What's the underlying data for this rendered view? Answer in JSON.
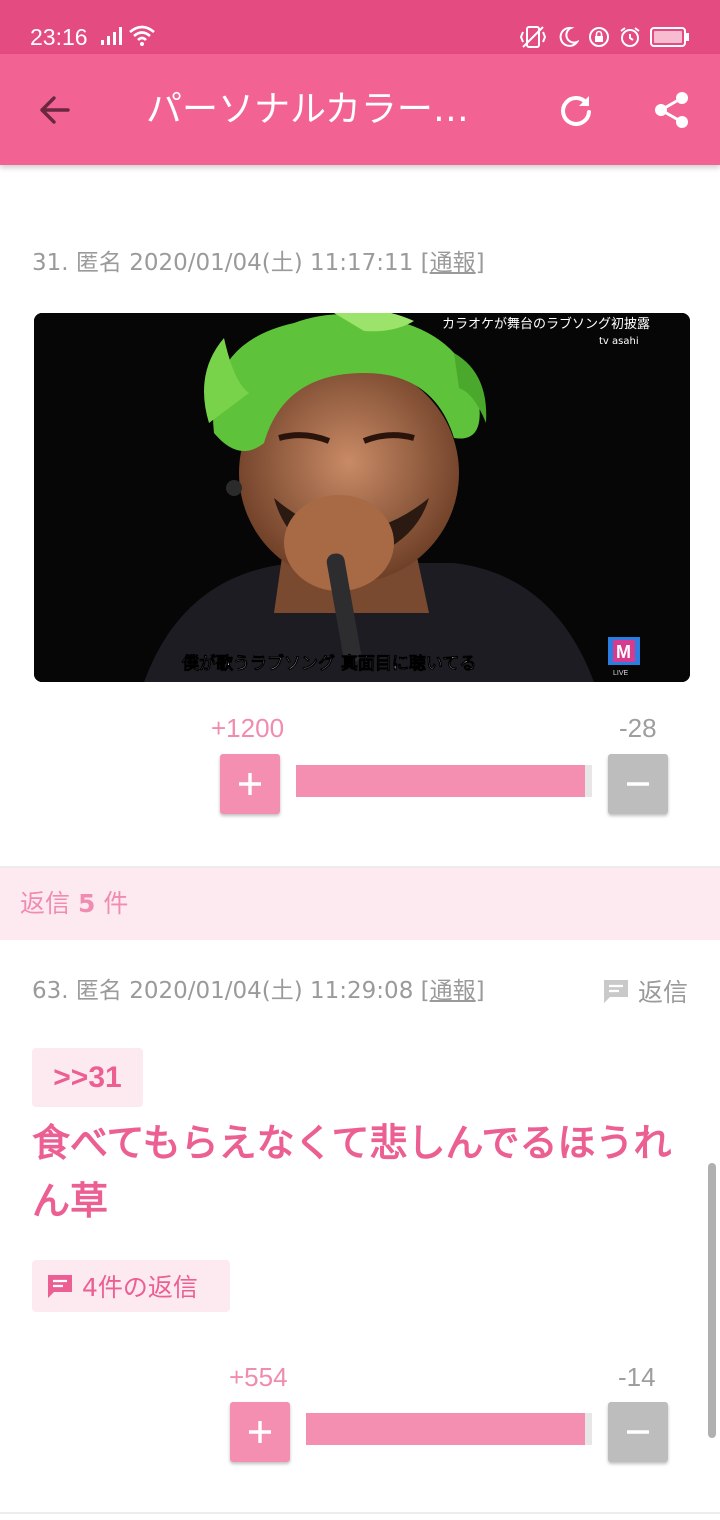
{
  "status_bar": {
    "time": "23:16"
  },
  "app_bar": {
    "title": "パーソナルカラー…"
  },
  "post": {
    "number": "31.",
    "author": "匿名",
    "datetime": "2020/01/04(土) 11:17:11",
    "report_open": "[",
    "report_label": "通報",
    "report_close": "]",
    "image": {
      "caption_top": "カラオケが舞台のラブソング初披露",
      "caption_channel": "tv asahi",
      "subtitle": "僕が歌うラブソング 真面目に聴いてる",
      "logo": "M",
      "logo_sub": "LIVE"
    },
    "votes": {
      "plus": "+1200",
      "minus": "-28",
      "plus_ratio": 0.977
    }
  },
  "replies_header": {
    "label": "返信",
    "count": "5",
    "unit": "件"
  },
  "reply": {
    "number": "63.",
    "author": "匿名",
    "datetime": "2020/01/04(土) 11:29:08",
    "report_open": "[",
    "report_label": "通報",
    "report_close": "]",
    "reply_action_label": "返信",
    "anchor": ">>31",
    "body": "食べてもらえなくて悲しんでるほうれん草",
    "replies_chip_label": "4件の返信",
    "votes": {
      "plus": "+554",
      "minus": "-14",
      "plus_ratio": 0.975
    }
  },
  "colors": {
    "status_bar": "#e44b80",
    "app_bar": "#f26394",
    "accent": "#ec5f92",
    "vote_bar": "#f48fb1",
    "minus_button": "#bdbdbd",
    "reply_bg": "#fdeaf1"
  },
  "icons": {
    "back": "arrow-left-icon",
    "refresh": "refresh-icon",
    "share": "share-icon",
    "comment": "comment-icon"
  }
}
